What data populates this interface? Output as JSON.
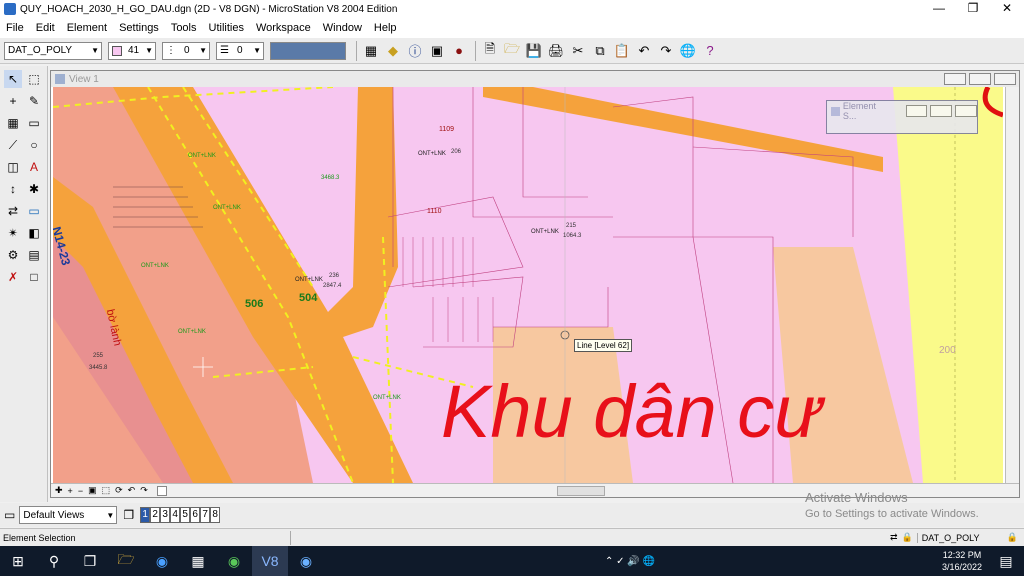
{
  "window": {
    "title": "QUY_HOACH_2030_H_GO_DAU.dgn (2D - V8 DGN) - MicroStation V8 2004 Edition"
  },
  "menu": [
    "File",
    "Edit",
    "Element",
    "Settings",
    "Tools",
    "Utilities",
    "Workspace",
    "Window",
    "Help"
  ],
  "toolbar": {
    "level": "DAT_O_POLY",
    "color": "41",
    "style": "0",
    "weight": "0"
  },
  "view": {
    "title": "View 1",
    "element_selection_title": "Element S..."
  },
  "drawing_labels": {
    "road": "N14-23",
    "parcel_a": "1109",
    "parcel_b": "1110",
    "parcel_c": "504",
    "parcel_d": "506",
    "area_200": "200",
    "big_text": "Khu dân cư",
    "landuse": "ONT+LNK",
    "bo_lanh": "bờ lành",
    "val_1": "206",
    "val_2": "236",
    "val_3": "2847.4",
    "val_4": "215",
    "val_5": "1064.3",
    "val_6": "3468.3",
    "val_7": "255",
    "val_8": "3445.8"
  },
  "tooltip": "Line [Level 62]",
  "bottom": {
    "view_set": "Default Views",
    "views": [
      "1",
      "2",
      "3",
      "4",
      "5",
      "6",
      "7",
      "8"
    ]
  },
  "status": {
    "left": "Element Selection",
    "level": "DAT_O_POLY"
  },
  "activation": {
    "line1": "Activate Windows",
    "line2": "Go to Settings to activate Windows."
  },
  "clock": {
    "time": "12:32 PM",
    "date": "3/16/2022"
  },
  "colors": {
    "parcel_pink": "#f7c7f0",
    "road_orange": "#f5a23c",
    "salmon": "#f2a08a",
    "label_green": "#22aa22",
    "red_text": "#e8101a",
    "yellow": "#fafa8a"
  }
}
